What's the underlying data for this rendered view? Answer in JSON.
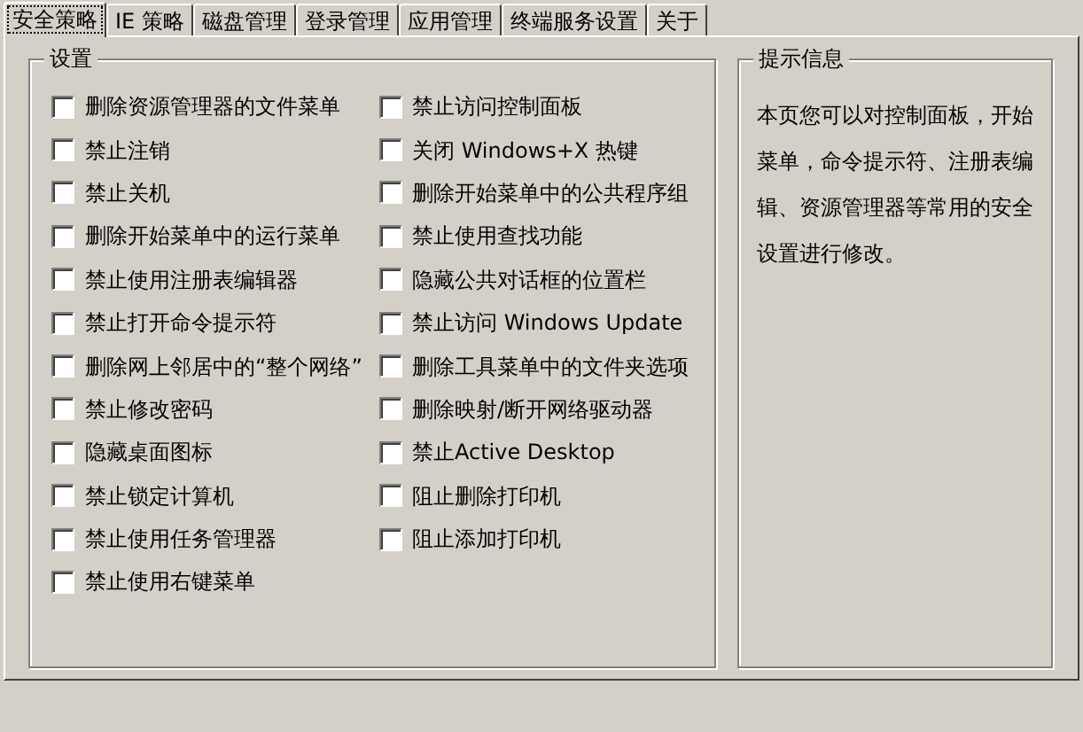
{
  "tabs": [
    {
      "label": "安全策略",
      "selected": true
    },
    {
      "label": "IE 策略",
      "selected": false
    },
    {
      "label": "磁盘管理",
      "selected": false
    },
    {
      "label": "登录管理",
      "selected": false
    },
    {
      "label": "应用管理",
      "selected": false
    },
    {
      "label": "终端服务设置",
      "selected": false
    },
    {
      "label": "关于",
      "selected": false
    }
  ],
  "settings": {
    "title": "设置",
    "left": [
      {
        "label": "删除资源管理器的文件菜单",
        "checked": false
      },
      {
        "label": "禁止注销",
        "checked": false
      },
      {
        "label": "禁止关机",
        "checked": false
      },
      {
        "label": "删除开始菜单中的运行菜单",
        "checked": false
      },
      {
        "label": "禁止使用注册表编辑器",
        "checked": false
      },
      {
        "label": "禁止打开命令提示符",
        "checked": false
      },
      {
        "label": "删除网上邻居中的“整个网络”",
        "checked": false
      },
      {
        "label": "禁止修改密码",
        "checked": false
      },
      {
        "label": "隐藏桌面图标",
        "checked": false
      },
      {
        "label": "禁止锁定计算机",
        "checked": false
      },
      {
        "label": "禁止使用任务管理器",
        "checked": false
      },
      {
        "label": "禁止使用右键菜单",
        "checked": false
      }
    ],
    "right": [
      {
        "label": "禁止访问控制面板",
        "checked": false
      },
      {
        "label": "关闭 Windows+X 热键",
        "checked": false
      },
      {
        "label": "删除开始菜单中的公共程序组",
        "checked": false
      },
      {
        "label": "禁止使用查找功能",
        "checked": false
      },
      {
        "label": "隐藏公共对话框的位置栏",
        "checked": false
      },
      {
        "label": "禁止访问 Windows Update",
        "checked": false
      },
      {
        "label": "删除工具菜单中的文件夹选项",
        "checked": false
      },
      {
        "label": "删除映射/断开网络驱动器",
        "checked": false
      },
      {
        "label": "禁止Active Desktop",
        "checked": false
      },
      {
        "label": "阻止删除打印机",
        "checked": false
      },
      {
        "label": "阻止添加打印机",
        "checked": false
      }
    ]
  },
  "info": {
    "title": "提示信息",
    "text": "本页您可以对控制面板，开始菜单，命令提示符、注册表编辑、资源管理器等常用的安全设置进行修改。"
  }
}
